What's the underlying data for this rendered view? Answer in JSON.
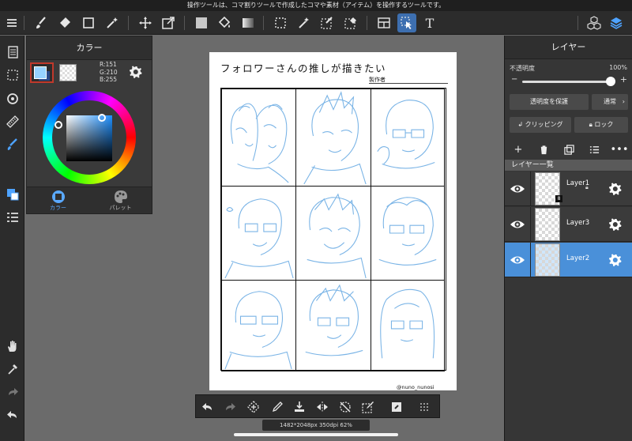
{
  "info_bar": {
    "text": "操作ツールは、コマ割りツールで作成したコマや素材（アイテム）を操作するツールです。"
  },
  "toolbar": {
    "menu_icon": "menu-icon",
    "tools": [
      "brush-icon",
      "eraser-icon",
      "rectangle-icon",
      "magic-wand-icon",
      "move-icon",
      "transform-icon",
      "fill-color-icon",
      "bucket-fill-icon",
      "gradient-icon",
      "select-rect-icon",
      "auto-select-icon",
      "select-pen-icon",
      "select-eraser-icon",
      "frame-divide-icon",
      "operation-icon",
      "text-icon"
    ],
    "text_tool_label": "T",
    "right_icons": [
      "3d-cubes-icon",
      "layers-icon"
    ]
  },
  "color_panel": {
    "title": "カラー",
    "foreground_color": "#97d2ff",
    "rgb": {
      "r": "R:151",
      "g": "G:210",
      "b": "B:255"
    },
    "tabs": [
      {
        "label": "カラー",
        "active": true
      },
      {
        "label": "パレット",
        "active": false
      }
    ]
  },
  "canvas": {
    "title": "フォロワーさんの推しが描きたい",
    "author_label": "製作者",
    "credit": "@nuno_nunosi",
    "sketch_color": "#7ab4e6"
  },
  "layer_panel": {
    "title": "レイヤー",
    "opacity_label": "不透明度",
    "opacity_value": "100%",
    "opacity_level": 1.0,
    "protect_button": "透明度を保護",
    "blend_mode": "通常",
    "clipping_button": "クリッピング",
    "lock_button": "ロック",
    "list_title": "レイヤー一覧",
    "layers": [
      {
        "name": "Layer1",
        "visible": true,
        "active": false,
        "locked": true,
        "badge": "8"
      },
      {
        "name": "Layer3",
        "visible": true,
        "active": false,
        "locked": false
      },
      {
        "name": "Layer2",
        "visible": true,
        "active": true,
        "locked": false
      }
    ]
  },
  "status": {
    "text": "1482*2048px 350dpi 62%"
  }
}
